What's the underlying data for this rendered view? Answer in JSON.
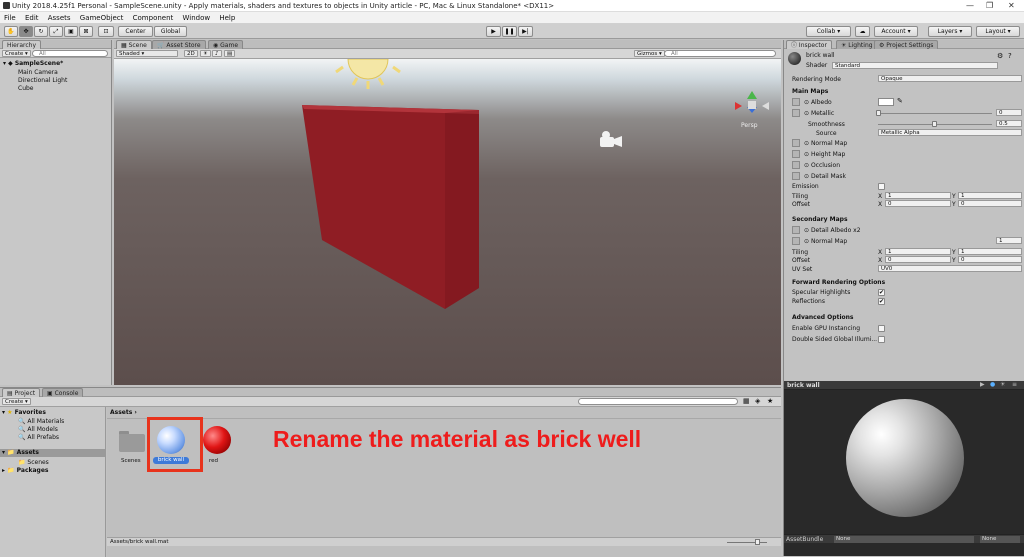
{
  "window": {
    "title": "Unity 2018.4.25f1 Personal - SampleScene.unity - Apply materials, shaders and textures to objects in Unity article - PC, Mac & Linux Standalone* <DX11>"
  },
  "menu": [
    "File",
    "Edit",
    "Assets",
    "GameObject",
    "Component",
    "Window",
    "Help"
  ],
  "toolbar": {
    "pivot": "Center",
    "space": "Global",
    "collab": "Collab",
    "account": "Account",
    "layers": "Layers",
    "layout": "Layout"
  },
  "hierarchy": {
    "tab": "Hierarchy",
    "create": "Create",
    "search_placeholder": "All",
    "scene": "SampleScene*",
    "items": [
      "Main Camera",
      "Directional Light",
      "Cube"
    ]
  },
  "scene": {
    "tabs": [
      "Scene",
      "Asset Store",
      "Game"
    ],
    "shading": "Shaded",
    "mode2d": "2D",
    "gizmos": "Gizmos",
    "search_placeholder": "All",
    "persp": "Persp"
  },
  "inspector": {
    "tabs": [
      "Inspector",
      "Lighting",
      "Project Settings"
    ],
    "material_name": "brick wall",
    "shader_label": "Shader",
    "shader": "Standard",
    "rendering_mode_label": "Rendering Mode",
    "rendering_mode": "Opaque",
    "main_maps": "Main Maps",
    "albedo": "Albedo",
    "metallic": "Metallic",
    "metallic_value": "0",
    "smoothness": "Smoothness",
    "smoothness_value": "0.5",
    "source": "Source",
    "source_value": "Metallic Alpha",
    "normal_map": "Normal Map",
    "height_map": "Height Map",
    "occlusion": "Occlusion",
    "detail_mask": "Detail Mask",
    "emission": "Emission",
    "tiling": "Tiling",
    "offset": "Offset",
    "x": "X",
    "y": "Y",
    "tiling_x": "1",
    "tiling_y": "1",
    "offset_x": "0",
    "offset_y": "0",
    "secondary_maps": "Secondary Maps",
    "detail_albedo": "Detail Albedo x2",
    "normal_map2": "Normal Map",
    "normal_map2_value": "1",
    "tiling2_x": "1",
    "tiling2_y": "1",
    "offset2_x": "0",
    "offset2_y": "0",
    "uv_set": "UV Set",
    "uv_set_value": "UV0",
    "forward_options": "Forward Rendering Options",
    "specular_highlights": "Specular Highlights",
    "reflections": "Reflections",
    "advanced_options": "Advanced Options",
    "gpu_instancing": "Enable GPU Instancing",
    "double_sided": "Double Sided Global Illumi..."
  },
  "preview": {
    "title": "brick wall",
    "assetbundle": "AssetBundle",
    "bundle_value": "None",
    "variant_value": "None"
  },
  "project": {
    "tabs": [
      "Project",
      "Console"
    ],
    "create": "Create",
    "favorites": "Favorites",
    "fav_items": [
      "All Materials",
      "All Models",
      "All Prefabs"
    ],
    "assets_root": "Assets",
    "scenes": "Scenes",
    "packages": "Packages",
    "breadcrumb": "Assets",
    "items": [
      "Scenes",
      "brick wall",
      "red"
    ],
    "status_path": "Assets/brick wall.mat"
  },
  "annotation": "Rename the material as brick well",
  "colors": {
    "wall": "#8e1c22",
    "highlight": "#e8331c",
    "selection": "#3d7ad8"
  }
}
